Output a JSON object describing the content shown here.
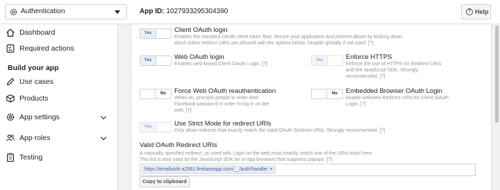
{
  "header": {
    "app_name": "Authentication",
    "app_id_label": "App ID:",
    "app_id_value": "1027933295304390",
    "help_label": "Help"
  },
  "sidebar": {
    "items": [
      {
        "label": "Dashboard",
        "icon": "home-icon"
      },
      {
        "label": "Required actions",
        "icon": "checklist-icon"
      }
    ],
    "section_title": "Build your app",
    "build_items": [
      {
        "label": "Use cases",
        "icon": "pencil-icon"
      },
      {
        "label": "Products",
        "icon": "box-icon"
      },
      {
        "label": "App settings",
        "icon": "gear-icon",
        "expandable": true
      },
      {
        "label": "App roles",
        "icon": "users-icon",
        "expandable": true
      },
      {
        "label": "Testing",
        "icon": "clipboard-icon"
      }
    ]
  },
  "settings": {
    "client_oauth": {
      "title": "Client OAuth login",
      "desc": "Enables the standard OAuth client token flow. Secure your application and prevent abuse by locking down which token redirect URIs are allowed with the options below. Disable globally if not used.",
      "q": "[?]",
      "toggle": "Yes"
    },
    "web_oauth": {
      "title": "Web OAuth login",
      "desc": "Enables web-based Client OAuth Login.",
      "q": "[?]",
      "toggle": "Yes"
    },
    "enforce_https": {
      "title": "Enforce HTTPS",
      "desc": "Enforce the use of HTTPS for Redirect URIs and the JavaScript SDK. Strongly recommended.",
      "q": "[?]",
      "toggle": "Yes"
    },
    "force_reauth": {
      "title": "Force Web OAuth reauthentication",
      "desc": "When on, prompts people to enter their Facebook password in order to log in on the web.",
      "q": "[?]",
      "toggle": "No"
    },
    "embedded_browser": {
      "title": "Embedded Browser OAuth Login",
      "desc": "Enable webview Redirect URIs for Client OAuth Login.",
      "q": "[?]",
      "toggle": "No"
    },
    "strict_mode": {
      "title": "Use Strict Mode for redirect URIs",
      "desc": "Only allow redirects that exactly match the Valid OAuth Redirect URIs. Strongly recommended.",
      "q": "[?]",
      "toggle": "Yes"
    }
  },
  "redirect": {
    "title": "Valid OAuth Redirect URIs",
    "desc1": "A manually specified redirect_uri used with Login on the web must exactly match one of the URIs listed here.",
    "desc2": "This list is also used by the JavaScript SDK for in-app browsers that suppress popups.",
    "q": "[?]",
    "uri": "https://emailauth-a2991.firebaseapp.com/__/auth/handler",
    "uri_remove": "×",
    "copy_label": "Copy to clipboard"
  },
  "colors": {
    "accent": "#4267b2",
    "muted": "#90949c",
    "background": "#f0f2f5"
  }
}
